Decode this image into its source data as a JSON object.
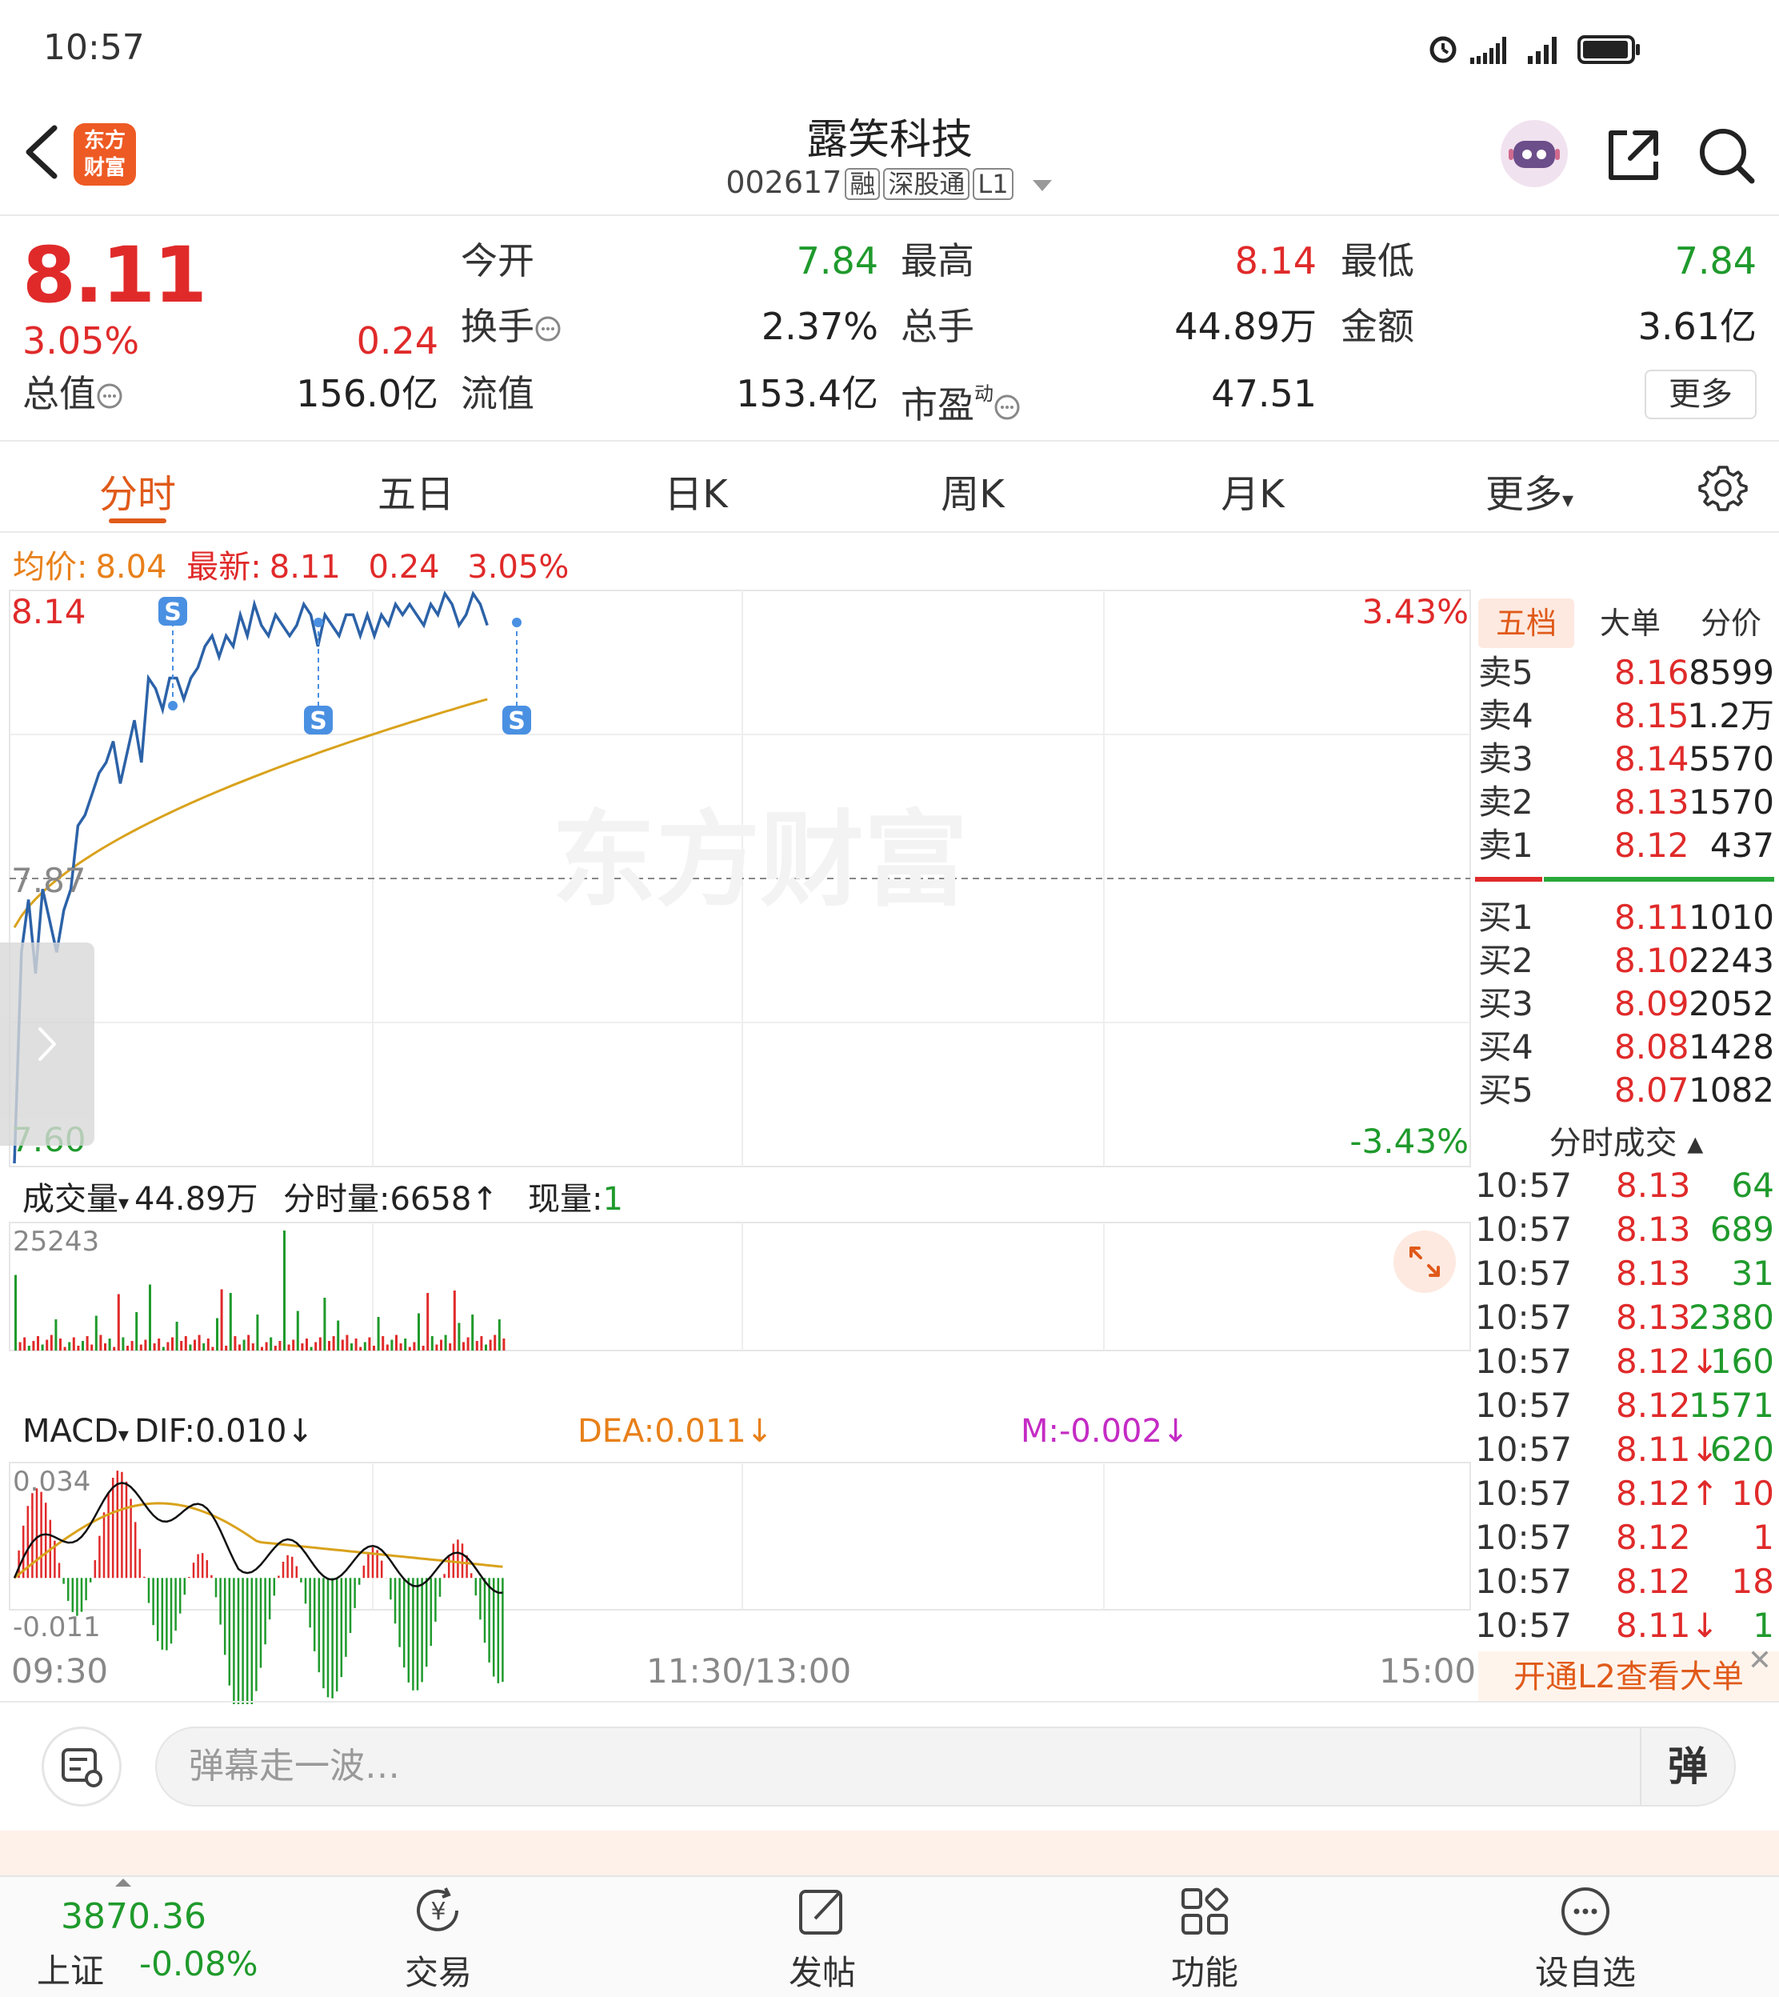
{
  "status_bar": {
    "time": "10:57"
  },
  "header": {
    "logo_line1": "东方",
    "logo_line2": "财富",
    "stock_name": "露笑科技",
    "stock_code": "002617",
    "tags": [
      "融",
      "深股通",
      "L1"
    ]
  },
  "quote": {
    "last_price": "8.11",
    "change_pct": "3.05%",
    "change": "0.24",
    "market_cap_label": "总值",
    "market_cap": "156.0亿",
    "open_label": "今开",
    "open": "7.84",
    "high_label": "最高",
    "high": "8.14",
    "low_label": "最低",
    "low": "7.84",
    "turnover_label": "换手",
    "turnover": "2.37%",
    "volume_label": "总手",
    "volume": "44.89万",
    "amount_label": "金额",
    "amount": "3.61亿",
    "float_cap_label": "流值",
    "float_cap": "153.4亿",
    "pe_label": "市盈",
    "pe_sup": "动",
    "pe": "47.51",
    "more_label": "更多"
  },
  "tabs": [
    "分时",
    "五日",
    "日K",
    "周K",
    "月K",
    "更多"
  ],
  "info_line": {
    "avg_label": "均价:",
    "avg": "8.04",
    "latest_label": "最新:",
    "latest": "8.11",
    "change": "0.24",
    "change_pct": "3.05%"
  },
  "chart_labels": {
    "price_high": "8.14",
    "price_low": "7.60",
    "price_ref": "7.87",
    "pct_high": "3.43%",
    "pct_low": "-3.43%",
    "volume_label": "成交量",
    "volume_total": "44.89万",
    "fenshi_vol": "分时量:6658↑",
    "current_vol_label": "现量:",
    "current_vol": "1",
    "vol_max": "25243",
    "macd_label": "MACD",
    "dif": "DIF:0.010↓",
    "dea": "DEA:0.011↓",
    "m": "M:-0.002↓",
    "macd_max": "0.034",
    "macd_min": "-0.011",
    "time_start": "09:30",
    "time_mid": "11:30/13:00",
    "time_end": "15:00",
    "watermark": "东方财富",
    "signal_marker": "S"
  },
  "order_book": {
    "tabs": [
      "五档",
      "大单",
      "分价"
    ],
    "sells": [
      {
        "label": "卖5",
        "price": "8.16",
        "vol": "8599"
      },
      {
        "label": "卖4",
        "price": "8.15",
        "vol": "1.2万"
      },
      {
        "label": "卖3",
        "price": "8.14",
        "vol": "5570"
      },
      {
        "label": "卖2",
        "price": "8.13",
        "vol": "1570"
      },
      {
        "label": "卖1",
        "price": "8.12",
        "vol": "437"
      }
    ],
    "buys": [
      {
        "label": "买1",
        "price": "8.11",
        "vol": "1010"
      },
      {
        "label": "买2",
        "price": "8.10",
        "vol": "2243"
      },
      {
        "label": "买3",
        "price": "8.09",
        "vol": "2052"
      },
      {
        "label": "买4",
        "price": "8.08",
        "vol": "1428"
      },
      {
        "label": "买5",
        "price": "8.07",
        "vol": "1082"
      }
    ],
    "tick_title": "分时成交 ▴",
    "ticks": [
      {
        "t": "10:57",
        "p": "8.13",
        "v": "64",
        "c": "green"
      },
      {
        "t": "10:57",
        "p": "8.13",
        "v": "689",
        "c": "green"
      },
      {
        "t": "10:57",
        "p": "8.13",
        "v": "31",
        "c": "green"
      },
      {
        "t": "10:57",
        "p": "8.13",
        "v": "2380",
        "c": "green"
      },
      {
        "t": "10:57",
        "p": "8.12↓",
        "v": "160",
        "c": "green"
      },
      {
        "t": "10:57",
        "p": "8.12",
        "v": "1571",
        "c": "green"
      },
      {
        "t": "10:57",
        "p": "8.11↓",
        "v": "620",
        "c": "green"
      },
      {
        "t": "10:57",
        "p": "8.12↑",
        "v": "10",
        "c": "red"
      },
      {
        "t": "10:57",
        "p": "8.12",
        "v": "1",
        "c": "red"
      },
      {
        "t": "10:57",
        "p": "8.12",
        "v": "18",
        "c": "red"
      },
      {
        "t": "10:57",
        "p": "8.11↓",
        "v": "1",
        "c": "green"
      }
    ],
    "l2_promo": "开通L2查看大单"
  },
  "danmu": {
    "placeholder": "弹幕走一波…",
    "send": "弹"
  },
  "bottom_nav": {
    "index_value": "3870.36",
    "index_name": "上证",
    "index_change": "-0.08%",
    "items": [
      "交易",
      "发帖",
      "功能",
      "设自选"
    ]
  },
  "colors": {
    "up": "#e02a2a",
    "down": "#1f9a2c",
    "accent": "#e05a1a",
    "price_line": "#2c62a8",
    "avg_line": "#d9a21c",
    "dif_line": "#111111",
    "dea_line": "#d9a21c",
    "signal_marker": "#4a90e2"
  }
}
